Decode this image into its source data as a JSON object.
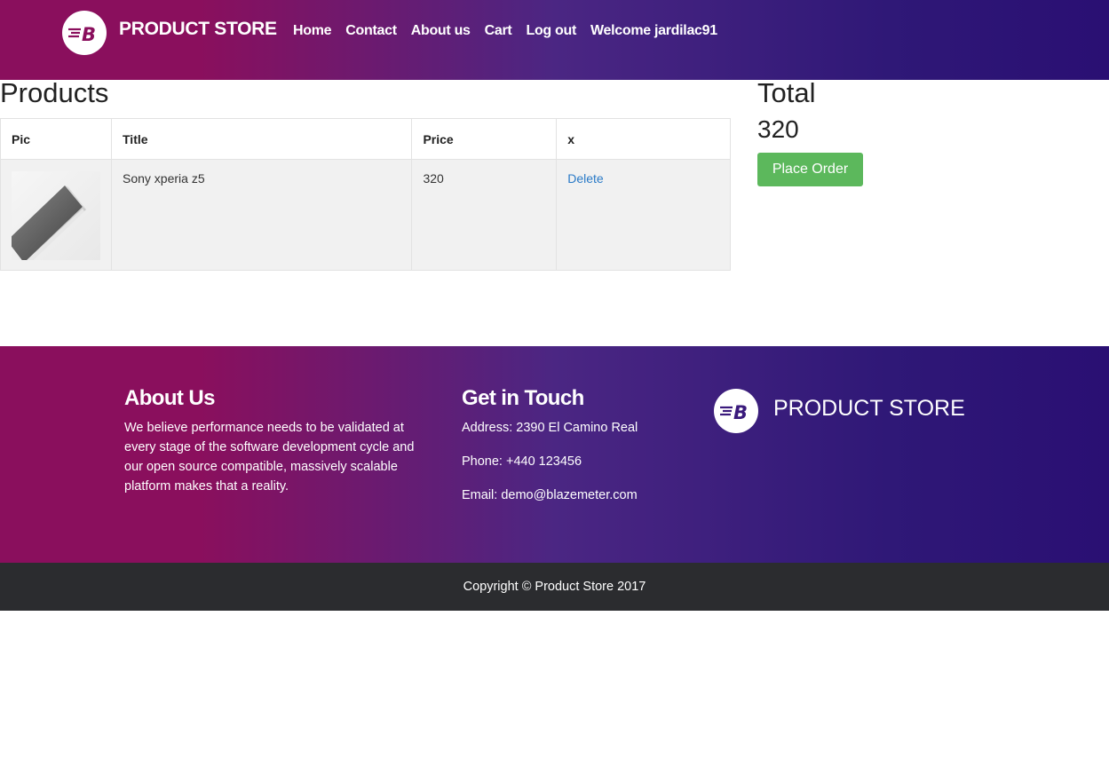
{
  "navbar": {
    "brand": "PRODUCT STORE",
    "links": [
      "Home",
      "Contact",
      "About us",
      "Cart",
      "Log out",
      "Welcome jardilac91"
    ]
  },
  "products": {
    "heading": "Products",
    "columns": [
      "Pic",
      "Title",
      "Price",
      "x"
    ],
    "rows": [
      {
        "title": "Sony xperia z5",
        "price": "320",
        "action": "Delete"
      }
    ]
  },
  "total": {
    "heading": "Total",
    "value": "320",
    "button": "Place Order"
  },
  "footer": {
    "about_heading": "About Us",
    "about_text": "We believe performance needs to be validated at every stage of the software development cycle and our open source compatible, massively scalable platform makes that a reality.",
    "contact_heading": "Get in Touch",
    "address": "Address: 2390 El Camino Real",
    "phone": "Phone: +440 123456",
    "email": "Email: demo@blazemeter.com",
    "brand": "PRODUCT STORE",
    "copyright": "Copyright © Product Store 2017"
  },
  "colors": {
    "gradient_start": "#8a0f5d",
    "gradient_end": "#2a0f73",
    "place_order": "#5cb85c",
    "link": "#2a7ac7",
    "copyright_bg": "#2b2c2f"
  }
}
